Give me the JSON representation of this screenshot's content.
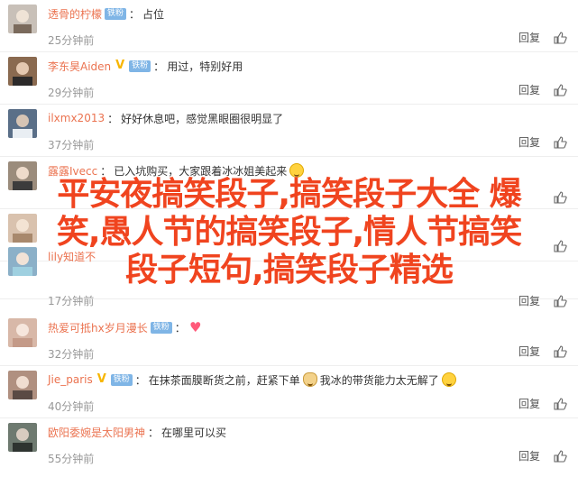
{
  "comments": [
    {
      "username": "透骨的柠檬",
      "has_v": false,
      "fan_badge": "铁粉",
      "text": "占位",
      "emoji": "",
      "time": "25分钟前",
      "avatar_color": "#c8c0b8"
    },
    {
      "username": "李东昊Aiden",
      "has_v": true,
      "fan_badge": "铁粉",
      "text": "用过，特别好用",
      "emoji": "",
      "time": "29分钟前",
      "avatar_color": "#8a6a50"
    },
    {
      "username": "ilxmx2013",
      "has_v": false,
      "fan_badge": "",
      "text": "好好休息吧，感觉黑眼圈很明显了",
      "emoji": "",
      "time": "37分钟前",
      "avatar_color": "#5a6f88"
    },
    {
      "username": "露露Ivecc",
      "has_v": false,
      "fan_badge": "",
      "text": "已入坑购买，大家跟着冰冰姐美起来",
      "emoji": "grin",
      "time": "",
      "avatar_color": "#9b8c7c"
    },
    {
      "username": "",
      "has_v": false,
      "fan_badge": "",
      "text": "",
      "emoji": "",
      "time": "",
      "avatar_color": "#d9c2ae"
    },
    {
      "username": "lily知道不",
      "has_v": false,
      "fan_badge": "",
      "text": "",
      "emoji": "",
      "time": "17分钟前",
      "avatar_color": "#8bb0c8"
    },
    {
      "username": "热爱可抵hx岁月漫长",
      "has_v": false,
      "fan_badge": "铁粉",
      "text": "",
      "emoji": "heart",
      "time": "32分钟前",
      "avatar_color": "#d8b8a8"
    },
    {
      "username": "Jie_paris",
      "has_v": true,
      "fan_badge": "铁粉",
      "text": "在抹茶面膜断货之前，赶紧下单",
      "text2": "我冰的带货能力太无解了",
      "emoji": "cat",
      "emoji2": "grin",
      "time": "40分钟前",
      "avatar_color": "#b09080"
    },
    {
      "username": "欧阳委婉是太阳男神",
      "has_v": false,
      "fan_badge": "",
      "text": "在哪里可以买",
      "emoji": "",
      "time": "55分钟前",
      "avatar_color": "#6e7a70"
    }
  ],
  "actions": {
    "reply": "回复"
  },
  "overlay": {
    "line1": "平安夜搞笑段子,搞笑段子大全 爆",
    "line2": "笑,愚人节的搞笑段子,情人节搞笑",
    "line3": "段子短句,搞笑段子精选"
  }
}
